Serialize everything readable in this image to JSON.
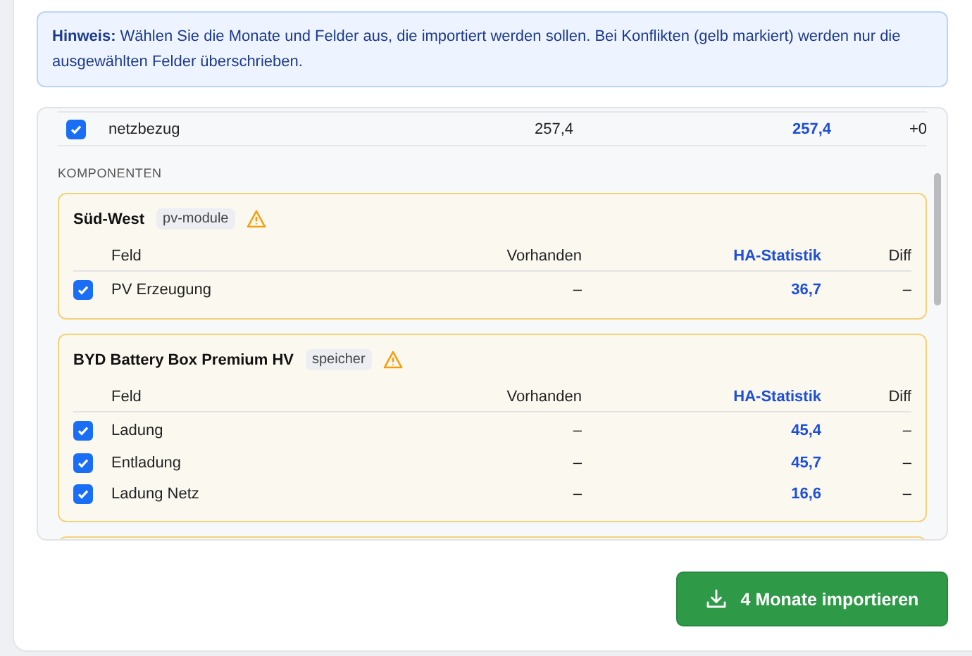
{
  "notice": {
    "label": "Hinweis:",
    "text": "Wählen Sie die Monate und Felder aus, die importiert werden sollen. Bei Konflikten (gelb markiert) werden nur die ausgewählten Felder überschrieben."
  },
  "summary_row": {
    "name": "netzbezug",
    "checked": true,
    "existing": "257,4",
    "statistic": "257,4",
    "diff": "+0"
  },
  "section_label": "KOMPONENTEN",
  "components": [
    {
      "name": "Süd-West",
      "tag": "pv-module",
      "conflict": true,
      "columns": [
        "Feld",
        "Vorhanden",
        "HA-Statistik",
        "Diff"
      ],
      "rows": [
        {
          "field": "PV Erzeugung",
          "checked": true,
          "existing": "–",
          "statistic": "36,7",
          "diff": "–"
        }
      ]
    },
    {
      "name": "BYD Battery Box Premium HV",
      "tag": "speicher",
      "conflict": true,
      "columns": [
        "Feld",
        "Vorhanden",
        "HA-Statistik",
        "Diff"
      ],
      "rows": [
        {
          "field": "Ladung",
          "checked": true,
          "existing": "–",
          "statistic": "45,4",
          "diff": "–"
        },
        {
          "field": "Entladung",
          "checked": true,
          "existing": "–",
          "statistic": "45,7",
          "diff": "–"
        },
        {
          "field": "Ladung Netz",
          "checked": true,
          "existing": "–",
          "statistic": "16,6",
          "diff": "–"
        }
      ]
    }
  ],
  "import_button": {
    "label": "4 Monate importieren"
  }
}
